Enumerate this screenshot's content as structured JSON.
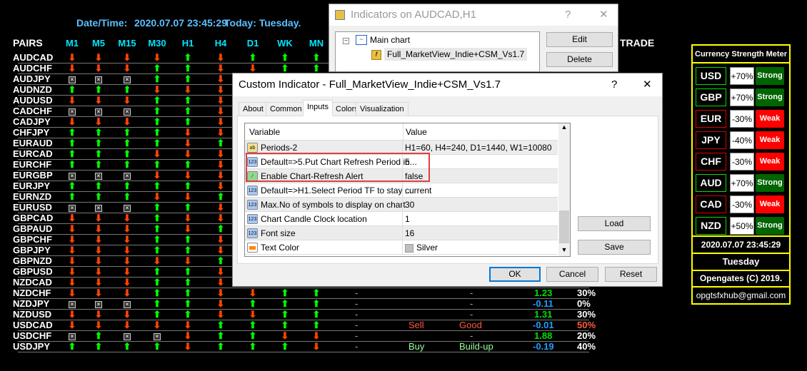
{
  "header": {
    "datetime_label": "Date/Time:",
    "datetime": "2020.07.07 23:45:29",
    "today": "Today: Tuesday."
  },
  "table": {
    "pairs_label": "PAIRS",
    "trade_label": "TRADE",
    "columns": [
      "M1",
      "M5",
      "M15",
      "M30",
      "H1",
      "H4",
      "D1",
      "WK",
      "MN"
    ],
    "rows": [
      {
        "pair": "AUDCAD",
        "s": [
          "d",
          "d",
          "d",
          "d",
          "u",
          "d",
          "u",
          "u",
          "u"
        ]
      },
      {
        "pair": "AUDCHF",
        "s": [
          "d",
          "d",
          "d",
          "u",
          "u",
          "d",
          "d",
          "u",
          "u"
        ]
      },
      {
        "pair": "AUDJPY",
        "s": [
          "x",
          "x",
          "x",
          "u",
          "u",
          "d"
        ]
      },
      {
        "pair": "AUDNZD",
        "s": [
          "u",
          "u",
          "u",
          "d",
          "d",
          "d"
        ]
      },
      {
        "pair": "AUDUSD",
        "s": [
          "d",
          "d",
          "d",
          "u",
          "u",
          "d"
        ]
      },
      {
        "pair": "CADCHF",
        "s": [
          "x",
          "x",
          "x",
          "u",
          "u",
          "d"
        ]
      },
      {
        "pair": "CADJPY",
        "s": [
          "d",
          "d",
          "d",
          "u",
          "u",
          "d"
        ]
      },
      {
        "pair": "CHFJPY",
        "s": [
          "u",
          "u",
          "u",
          "u",
          "d",
          "d"
        ]
      },
      {
        "pair": "EURAUD",
        "s": [
          "u",
          "u",
          "u",
          "u",
          "d",
          "u"
        ]
      },
      {
        "pair": "EURCAD",
        "s": [
          "u",
          "u",
          "u",
          "d",
          "d",
          "d"
        ]
      },
      {
        "pair": "EURCHF",
        "s": [
          "u",
          "u",
          "u",
          "u",
          "u",
          "d"
        ]
      },
      {
        "pair": "EURGBP",
        "s": [
          "x",
          "x",
          "x",
          "d",
          "d",
          "d"
        ]
      },
      {
        "pair": "EURJPY",
        "s": [
          "u",
          "u",
          "u",
          "u",
          "u",
          "d"
        ]
      },
      {
        "pair": "EURNZD",
        "s": [
          "u",
          "u",
          "u",
          "d",
          "d",
          "u"
        ]
      },
      {
        "pair": "EURUSD",
        "s": [
          "x",
          "x",
          "x",
          "u",
          "u",
          "d"
        ]
      },
      {
        "pair": "GBPCAD",
        "s": [
          "d",
          "d",
          "d",
          "u",
          "d",
          "d"
        ]
      },
      {
        "pair": "GBPAUD",
        "s": [
          "d",
          "d",
          "d",
          "u",
          "d",
          "u"
        ]
      },
      {
        "pair": "GBPCHF",
        "s": [
          "d",
          "d",
          "d",
          "u",
          "u",
          "d"
        ]
      },
      {
        "pair": "GBPJPY",
        "s": [
          "d",
          "d",
          "d",
          "u",
          "u",
          "d"
        ]
      },
      {
        "pair": "GBPNZD",
        "s": [
          "d",
          "d",
          "d",
          "d",
          "d",
          "u"
        ]
      },
      {
        "pair": "GBPUSD",
        "s": [
          "d",
          "d",
          "d",
          "u",
          "u",
          "d"
        ]
      },
      {
        "pair": "NZDCAD",
        "s": [
          "d",
          "d",
          "d",
          "u",
          "u",
          "d"
        ]
      },
      {
        "pair": "NZDCHF",
        "s": [
          "d",
          "d",
          "d",
          "u",
          "u",
          "d",
          "d",
          "u",
          "u"
        ],
        "dash": "-",
        "signal": "",
        "strength": "-",
        "value": "1.23",
        "pct": "30%"
      },
      {
        "pair": "NZDJPY",
        "s": [
          "x",
          "x",
          "x",
          "u",
          "u",
          "d",
          "u",
          "u",
          "u"
        ],
        "dash": "-",
        "signal": "",
        "strength": "-",
        "value": "-0.11",
        "pct": "0%"
      },
      {
        "pair": "NZDUSD",
        "s": [
          "d",
          "d",
          "d",
          "u",
          "u",
          "d",
          "d",
          "u",
          "u"
        ],
        "dash": "-",
        "signal": "",
        "strength": "-",
        "value": "1.31",
        "pct": "30%"
      },
      {
        "pair": "USDCAD",
        "s": [
          "d",
          "d",
          "d",
          "d",
          "d",
          "u",
          "u",
          "u",
          "u"
        ],
        "dash": "-",
        "signal": "Sell",
        "strength": "Good",
        "value": "-0.01",
        "pct": "50%"
      },
      {
        "pair": "USDCHF",
        "s": [
          "x",
          "u",
          "x",
          "x",
          "d",
          "u",
          "u",
          "d",
          "d"
        ],
        "dash": "-",
        "signal": "",
        "strength": "-",
        "value": "1.88",
        "pct": "20%"
      },
      {
        "pair": "USDJPY",
        "s": [
          "u",
          "u",
          "u",
          "u",
          "d",
          "u",
          "u",
          "u",
          "d"
        ],
        "dash": "-",
        "signal": "Buy",
        "strength": "Build-up",
        "value": "-0.19",
        "pct": "40%"
      }
    ]
  },
  "colors": {
    "up": "#00ff00",
    "down": "#ff4500",
    "sell": "#ff5a3c",
    "buy": "#99ff99",
    "pos_value": "#00e000",
    "neg_value": "#1e9fff",
    "strong": "#006400",
    "weak": "#ff0000",
    "frame": "#ffff00"
  },
  "indicators_dialog": {
    "title": "Indicators on AUDCAD,H1",
    "help": "?",
    "close": "✕",
    "tree_root": "Main chart",
    "tree_child": "Full_MarketView_Indie+CSM_Vs1.7",
    "edit": "Edit",
    "delete": "Delete"
  },
  "custom_dialog": {
    "title": "Custom Indicator - Full_MarketView_Indie+CSM_Vs1.7",
    "help": "?",
    "close": "✕",
    "tabs": [
      "About",
      "Common",
      "Inputs",
      "Colors",
      "Visualization"
    ],
    "active_tab": "Inputs",
    "col_variable": "Variable",
    "col_value": "Value",
    "rows": [
      {
        "icon": "ab",
        "name": "Periods-2",
        "value": "H1=60, H4=240, D1=1440, W1=10080"
      },
      {
        "icon": "123",
        "name": "Default=>5.Put Chart Refresh Period in...",
        "value": "5"
      },
      {
        "icon": "bool",
        "name": "Enable Chart-Refresh Alert",
        "value": "false"
      },
      {
        "icon": "123",
        "name": "Default=>H1.Select Period TF to stay ...",
        "value": "current"
      },
      {
        "icon": "123",
        "name": "Max.No of symbols to display on chart",
        "value": "30"
      },
      {
        "icon": "123",
        "name": "Chart Candle Clock location",
        "value": "1"
      },
      {
        "icon": "123",
        "name": "Font size",
        "value": "16"
      },
      {
        "icon": "color",
        "name": "Text Color",
        "value": "Silver"
      }
    ],
    "load": "Load",
    "save": "Save",
    "ok": "OK",
    "cancel": "Cancel",
    "reset": "Reset"
  },
  "csm": {
    "title": "Currency Strength Meter",
    "items": [
      {
        "cur": "USD",
        "pct": "+70%",
        "label": "Strong"
      },
      {
        "cur": "GBP",
        "pct": "+70%",
        "label": "Strong"
      },
      {
        "cur": "EUR",
        "pct": "-30%",
        "label": "Weak"
      },
      {
        "cur": "JPY",
        "pct": "-40%",
        "label": "Weak"
      },
      {
        "cur": "CHF",
        "pct": "-30%",
        "label": "Weak"
      },
      {
        "cur": "AUD",
        "pct": "+70%",
        "label": "Strong"
      },
      {
        "cur": "CAD",
        "pct": "-30%",
        "label": "Weak"
      },
      {
        "cur": "NZD",
        "pct": "+50%",
        "label": "Strong"
      }
    ],
    "datetime": "2020.07.07 23:45:29",
    "day": "Tuesday",
    "copyright": "Opengates (C) 2019.",
    "email": "opgtsfxhub@gmail.com"
  }
}
